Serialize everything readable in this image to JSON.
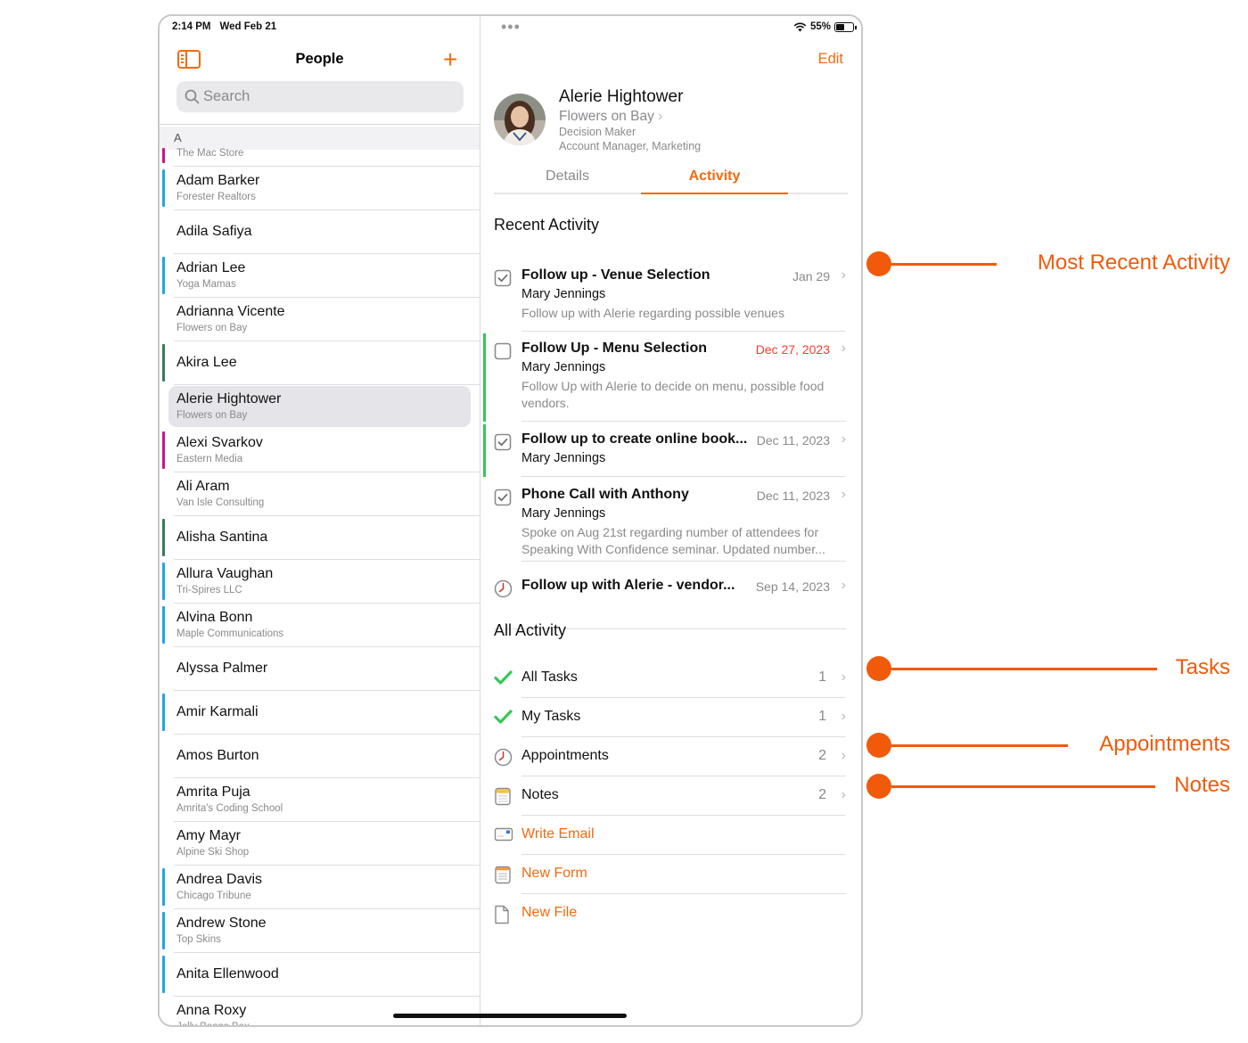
{
  "status_bar": {
    "time": "2:14 PM",
    "date": "Wed Feb 21",
    "battery": "55%"
  },
  "sidebar": {
    "title": "People",
    "search_placeholder": "Search",
    "section_letter": "A",
    "rows": [
      {
        "name": "",
        "company": "The Mac Store",
        "bar_color": "#c6168d"
      },
      {
        "name": "Adam Barker",
        "company": "Forester Realtors",
        "bar_color": "#1fa7e1"
      },
      {
        "name": "Adila Safiya",
        "company": "",
        "bar_color": ""
      },
      {
        "name": "Adrian Lee",
        "company": "Yoga Mamas",
        "bar_color": "#1fa7e1"
      },
      {
        "name": "Adrianna Vicente",
        "company": "Flowers on Bay",
        "bar_color": ""
      },
      {
        "name": "Akira Lee",
        "company": "",
        "bar_color": "#3a7a5a"
      },
      {
        "name": "Alerie Hightower",
        "company": "Flowers on Bay",
        "bar_color": "",
        "selected": true
      },
      {
        "name": "Alexi Svarkov",
        "company": "Eastern Media",
        "bar_color": "#c6168d"
      },
      {
        "name": "Ali Aram",
        "company": "Van Isle Consulting",
        "bar_color": ""
      },
      {
        "name": "Alisha Santina",
        "company": "",
        "bar_color": "#3a7a5a"
      },
      {
        "name": "Allura Vaughan",
        "company": "Tri-Spires LLC",
        "bar_color": "#1fa7e1"
      },
      {
        "name": "Alvina Bonn",
        "company": "Maple Communications",
        "bar_color": "#1fa7e1"
      },
      {
        "name": "Alyssa Palmer",
        "company": "",
        "bar_color": ""
      },
      {
        "name": "Amir Karmali",
        "company": "",
        "bar_color": "#1fa7e1"
      },
      {
        "name": "Amos Burton",
        "company": "",
        "bar_color": ""
      },
      {
        "name": "Amrita Puja",
        "company": "Amrita's Coding School",
        "bar_color": ""
      },
      {
        "name": "Amy Mayr",
        "company": "Alpine Ski Shop",
        "bar_color": ""
      },
      {
        "name": "Andrea Davis",
        "company": "Chicago Tribune",
        "bar_color": "#1fa7e1"
      },
      {
        "name": "Andrew Stone",
        "company": "Top Skins",
        "bar_color": "#1fa7e1"
      },
      {
        "name": "Anita Ellenwood",
        "company": "",
        "bar_color": "#1fa7e1"
      },
      {
        "name": "Anna Roxy",
        "company": "Jelly Beans Box",
        "bar_color": ""
      }
    ]
  },
  "detail": {
    "edit_label": "Edit",
    "name": "Alerie Hightower",
    "company": "Flowers on Bay",
    "role": "Decision Maker",
    "job_title": "Account Manager, Marketing",
    "tabs": {
      "details": "Details",
      "activity": "Activity"
    },
    "recent_heading": "Recent Activity",
    "recent": [
      {
        "title": "Follow up - Venue Selection",
        "date": "Jan 29",
        "person": "Mary Jennings",
        "desc": "Follow up with Alerie regarding possible venues",
        "icon": "checked-box-icon"
      },
      {
        "title": "Follow Up - Menu Selection",
        "date": "Dec 27, 2023",
        "person": "Mary Jennings",
        "desc": "Follow Up with Alerie to decide on menu, possible food vendors.",
        "icon": "empty-box-icon"
      },
      {
        "title": "Follow up to create online book...",
        "date": "Dec 11, 2023",
        "person": "Mary Jennings",
        "desc": "",
        "icon": "checked-box-icon"
      },
      {
        "title": "Phone Call with Anthony",
        "date": "Dec 11, 2023",
        "person": "Mary Jennings",
        "desc": "Spoke on Aug 21st regarding number of attendees for Speaking With Confidence seminar. Updated number...",
        "icon": "checked-box-icon"
      },
      {
        "title": "Follow up with Alerie - vendor...",
        "date": "Sep 14, 2023",
        "person": "",
        "desc": "",
        "icon": "clock-icon"
      }
    ],
    "all_heading": "All Activity",
    "all": [
      {
        "label": "All Tasks",
        "count": "1",
        "icon": "green-check-icon"
      },
      {
        "label": "My Tasks",
        "count": "1",
        "icon": "green-check-icon"
      },
      {
        "label": "Appointments",
        "count": "2",
        "icon": "clock-icon"
      },
      {
        "label": "Notes",
        "count": "2",
        "icon": "notepad-icon"
      },
      {
        "label": "Write Email",
        "count": "",
        "icon": "email-icon"
      },
      {
        "label": "New Form",
        "count": "",
        "icon": "form-icon"
      },
      {
        "label": "New File",
        "count": "",
        "icon": "file-icon"
      }
    ]
  },
  "callouts": {
    "most_recent": "Most Recent Activity",
    "tasks": "Tasks",
    "appointments": "Appointments",
    "notes": "Notes"
  },
  "colors": {
    "accent": "#f26a0f",
    "callout": "#f05a0a",
    "overdue": "#ff3b30",
    "task_green": "#34c759"
  }
}
